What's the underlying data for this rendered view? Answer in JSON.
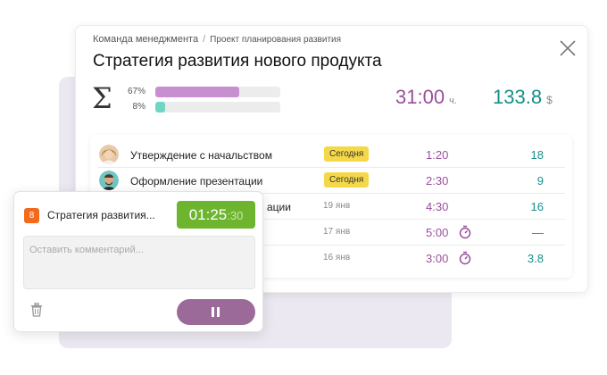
{
  "breadcrumb": [
    "Команда менеджмента",
    "Проект планирования развития"
  ],
  "breadcrumb_separator": "/",
  "title": "Стратегия развития нового продукта",
  "summary": {
    "symbol": "Σ",
    "bars": [
      {
        "label": "67%",
        "value": 0.67,
        "color": "#c78fcf"
      },
      {
        "label": "8%",
        "value": 0.08,
        "color": "#6fd6c4"
      }
    ],
    "time": "31:00",
    "time_unit": "ч.",
    "amount": "133.8",
    "amount_unit": "$"
  },
  "tasks": [
    {
      "name": "Утверждение с начальством",
      "badge": "Сегодня",
      "date": "",
      "time": "1:20",
      "amount": "18",
      "stopwatch": false,
      "avatar": "woman"
    },
    {
      "name": "Оформление презентации",
      "badge": "Сегодня",
      "date": "",
      "time": "2:30",
      "amount": "9",
      "stopwatch": false,
      "avatar": "man"
    },
    {
      "name": "ации",
      "badge": "",
      "date": "19 янв",
      "time": "4:30",
      "amount": "16",
      "stopwatch": false,
      "avatar": ""
    },
    {
      "name": "",
      "badge": "",
      "date": "17 янв",
      "time": "5:00",
      "amount": "—",
      "stopwatch": true,
      "avatar": ""
    },
    {
      "name": "",
      "badge": "",
      "date": "16 янв",
      "time": "3:00",
      "amount": "3.8",
      "stopwatch": true,
      "avatar": ""
    }
  ],
  "popup": {
    "number": "8",
    "task": "Стратегия развития...",
    "timer_main": "01:25",
    "timer_secs": ":30",
    "comment_placeholder": "Оставить комментарий..."
  },
  "icons": {
    "close": "close-icon",
    "stopwatch": "stopwatch-icon",
    "trash": "trash-icon",
    "pause": "pause-icon"
  },
  "colors": {
    "time": "#9a4f9a",
    "amount": "#168f8a",
    "badge": "#f5d84a",
    "timer": "#6db52e",
    "pause_button": "#9b6a98",
    "task_number": "#f26b1d"
  }
}
